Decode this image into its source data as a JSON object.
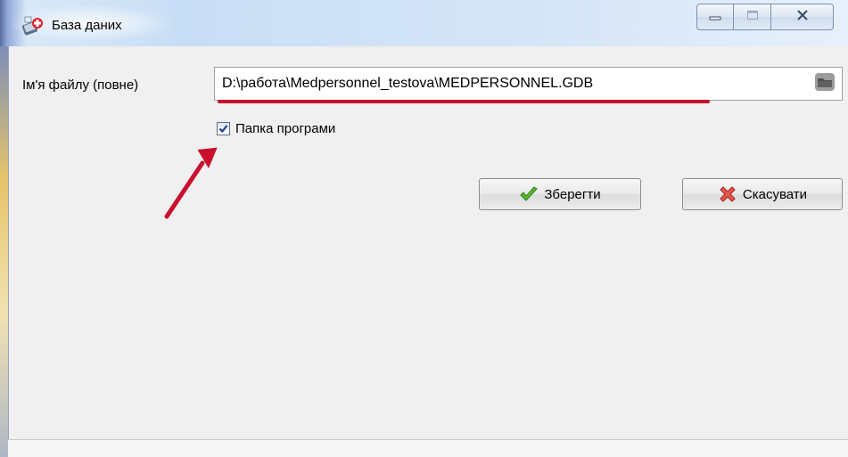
{
  "window": {
    "title": "База даних",
    "icon": "database-medical-icon",
    "controls": {
      "minimize": "minimize-icon",
      "maximize": "maximize-icon",
      "close": "close-icon"
    }
  },
  "form": {
    "file_label": "Ім'я файлу (повне)",
    "file_path": "D:\\работа\\Medpersonnel_testova\\MEDPERSONNEL.GDB",
    "browse_icon": "folder-icon",
    "program_folder_label": "Папка програми",
    "program_folder_checked": true
  },
  "buttons": {
    "save_label": "Зберегти",
    "save_icon": "check-icon",
    "cancel_label": "Скасувати",
    "cancel_icon": "cross-icon"
  },
  "annotations": {
    "underline_color": "#c8102e",
    "arrow_color": "#c8102e"
  },
  "colors": {
    "client_bg": "#f0f0f0",
    "titlebar_accent": "#c8def5"
  }
}
